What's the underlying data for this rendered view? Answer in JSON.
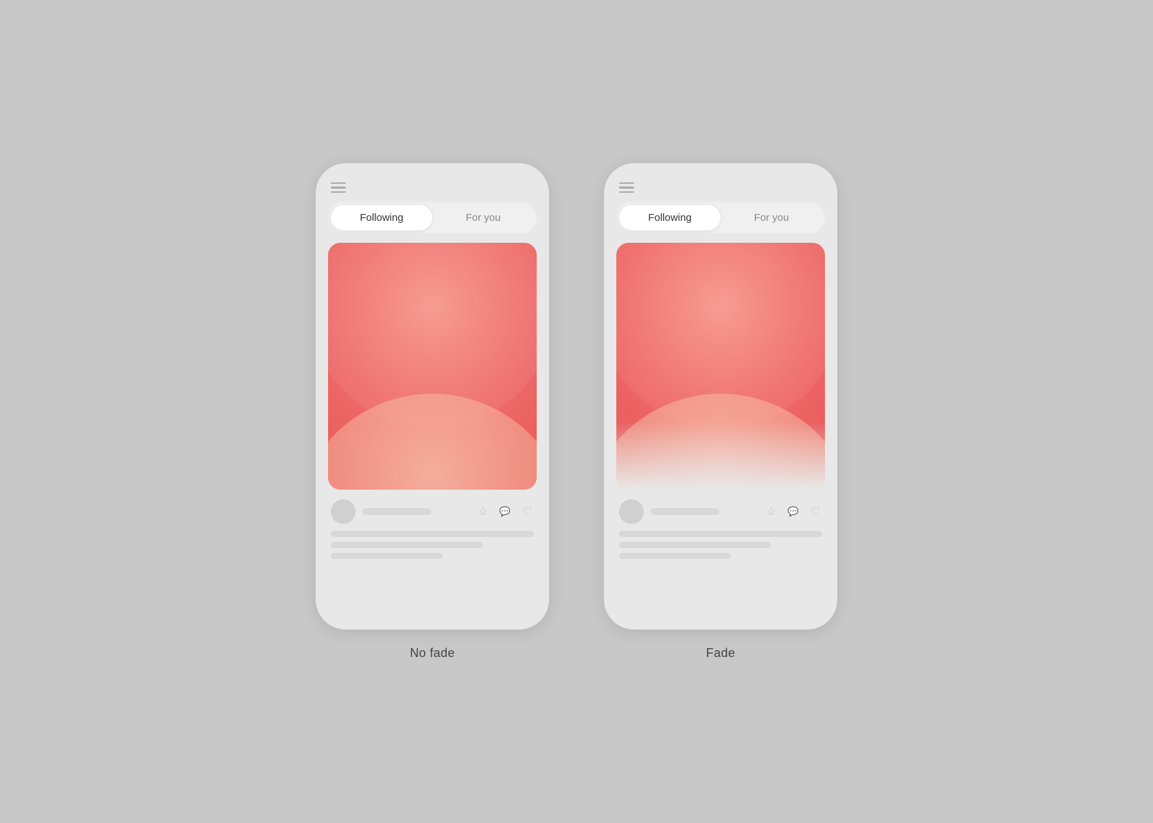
{
  "background_color": "#c8c8c8",
  "phones": [
    {
      "id": "no-fade",
      "label": "No fade",
      "tab_following": "Following",
      "tab_for_you": "For you",
      "active_tab": "following",
      "has_fade": false
    },
    {
      "id": "fade",
      "label": "Fade",
      "tab_following": "Following",
      "tab_for_you": "For you",
      "active_tab": "following",
      "has_fade": true
    }
  ],
  "icons": {
    "hamburger": "hamburger-menu",
    "star": "star",
    "chat": "chat-bubble",
    "heart": "heart"
  }
}
